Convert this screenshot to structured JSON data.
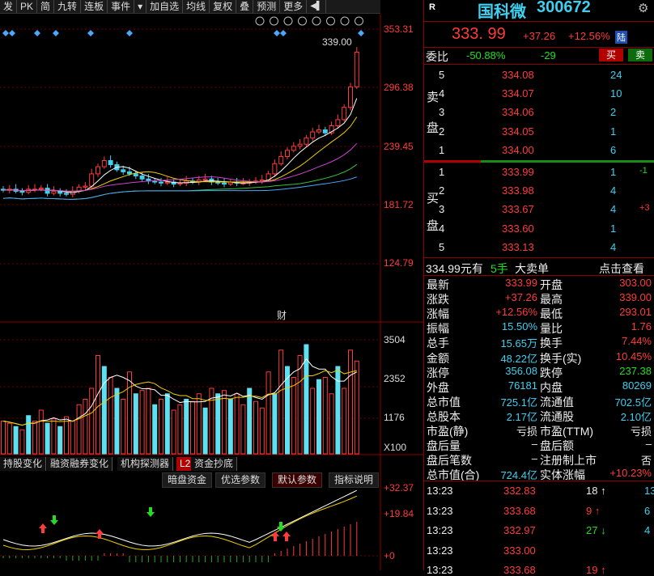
{
  "toolbar": {
    "items": [
      "发",
      "PK",
      "简",
      "九转",
      "连板",
      "事件",
      "▾",
      "加自选",
      "均线",
      "复权",
      "叠",
      "预测",
      "更多"
    ],
    "nav_icon": "pager-icon"
  },
  "main_chart": {
    "price_axis": [
      "353.31",
      "296.38",
      "239.45",
      "181.72",
      "124.79"
    ],
    "max_label": "339.00",
    "event_label": "财"
  },
  "volume_chart": {
    "axis": [
      "3504",
      "2352",
      "1176",
      "X100"
    ]
  },
  "tabs": [
    "持股变化",
    "融资融券变化",
    "机构探测器",
    "L2",
    "资金抄底"
  ],
  "indicator_tabs": [
    "暗盘资金",
    "优选参数",
    "默认参数",
    "指标说明"
  ],
  "indicator_axis": [
    "+32.37",
    "+19.84",
    "+0"
  ],
  "stock": {
    "badge": "R",
    "name": "国科微",
    "code": "300672",
    "price": "333. 99",
    "change": "+37.26",
    "change_pct": "+12.56%",
    "market_badge": "陆"
  },
  "commission": {
    "label": "委比",
    "ratio": "-50.88%",
    "diff": "-29",
    "buy_btn": "买",
    "sell_btn": "卖"
  },
  "sell_orders": [
    {
      "level": "5",
      "price": "334.08",
      "vol": "24"
    },
    {
      "level": "4",
      "price": "334.07",
      "vol": "10"
    },
    {
      "level": "3",
      "price": "334.06",
      "vol": "2"
    },
    {
      "level": "2",
      "price": "334.05",
      "vol": "1"
    },
    {
      "level": "1",
      "price": "334.00",
      "vol": "6"
    }
  ],
  "sell_label": [
    "卖",
    "盘"
  ],
  "buy_orders": [
    {
      "level": "1",
      "price": "333.99",
      "vol": "1",
      "chg": "-1"
    },
    {
      "level": "2",
      "price": "333.98",
      "vol": "4",
      "chg": ""
    },
    {
      "level": "3",
      "price": "333.67",
      "vol": "4",
      "chg": "+3"
    },
    {
      "level": "4",
      "price": "333.60",
      "vol": "1",
      "chg": ""
    },
    {
      "level": "5",
      "price": "333.13",
      "vol": "4",
      "chg": ""
    }
  ],
  "buy_label": [
    "买",
    "盘"
  ],
  "big_order": {
    "price": "334.99元有",
    "qty": "5手",
    "type": "大卖单",
    "link": "点击查看"
  },
  "stats": [
    {
      "l": "最新",
      "v": "333.99",
      "l2": "开盘",
      "v2": "303.00"
    },
    {
      "l": "涨跌",
      "v": "+37.26",
      "l2": "最高",
      "v2": "339.00"
    },
    {
      "l": "涨幅",
      "v": "+12.56%",
      "l2": "最低",
      "v2": "293.01"
    },
    {
      "l": "振幅",
      "v": "15.50%",
      "l2": "量比",
      "v2": "1.76"
    },
    {
      "l": "总手",
      "v": "15.65万",
      "l2": "换手",
      "v2": "7.44%"
    },
    {
      "l": "金额",
      "v": "48.22亿",
      "l2": "换手(实)",
      "v2": "10.45%"
    },
    {
      "l": "涨停",
      "v": "356.08",
      "l2": "跌停",
      "v2": "237.38"
    },
    {
      "l": "外盘",
      "v": "76181",
      "l2": "内盘",
      "v2": "80269"
    },
    {
      "l": "总市值",
      "v": "725.1亿",
      "l2": "流通值",
      "v2": "702.5亿"
    },
    {
      "l": "总股本",
      "v": "2.17亿",
      "l2": "流通股",
      "v2": "2.10亿"
    },
    {
      "l": "市盈(静)",
      "v": "亏损",
      "l2": "市盈(TTM)",
      "v2": "亏损"
    },
    {
      "l": "盘后量",
      "v": "–",
      "l2": "盘后额",
      "v2": "–"
    },
    {
      "l": "盘后笔数",
      "v": "–",
      "l2": "注册制上市",
      "v2": "否"
    },
    {
      "l": "总市值(合)",
      "v": "724.4亿",
      "l2": "实体涨幅",
      "v2": "+10.23%"
    }
  ],
  "ticks": [
    {
      "t": "13:23",
      "p": "332.83",
      "v": "18",
      "dir": "up-w",
      "n": "13"
    },
    {
      "t": "13:23",
      "p": "333.68",
      "v": "9",
      "dir": "up",
      "n": "6"
    },
    {
      "t": "13:23",
      "p": "332.97",
      "v": "27",
      "dir": "down",
      "n": "4"
    },
    {
      "t": "13:23",
      "p": "333.00",
      "v": "",
      "dir": "",
      "n": ""
    },
    {
      "t": "13:23",
      "p": "333.68",
      "v": "19",
      "dir": "up",
      "n": ""
    }
  ]
}
